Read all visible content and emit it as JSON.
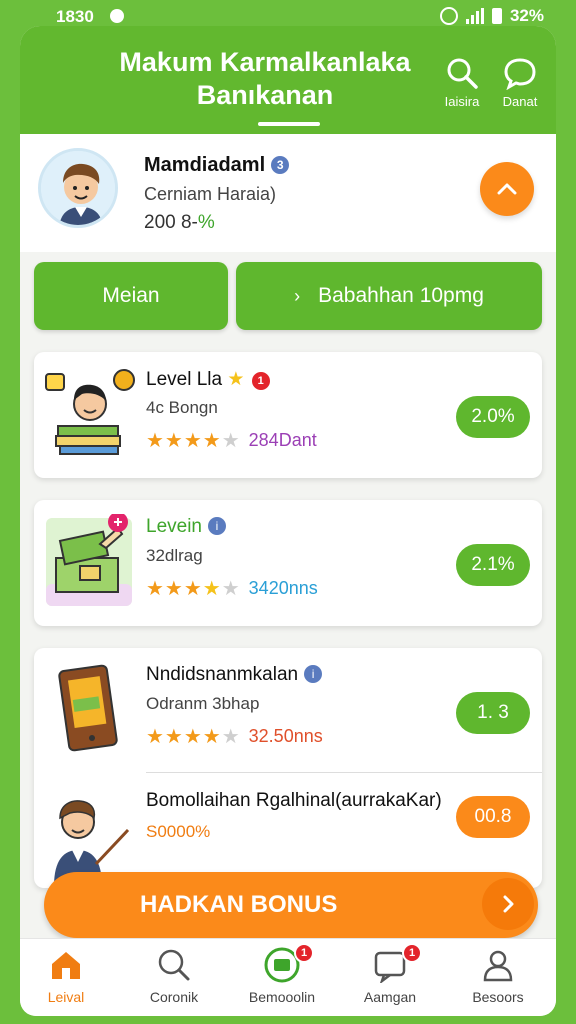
{
  "status_bar": {
    "time": "1830",
    "battery": "32%"
  },
  "header": {
    "title_line1": "Makum Karmalkanlaka",
    "title_line2": "Banıkanan",
    "search_label": "Iaisira",
    "chat_label": "Danat",
    "chat_badge": ""
  },
  "profile": {
    "name": "Mamdiadaml",
    "info_badge": "3",
    "subtitle": "Cerniam Haraia)",
    "stat_prefix": "200 8-",
    "stat_pct": "%"
  },
  "actions": {
    "left_label": "Meian",
    "right_label": "Babahhan 10pmg"
  },
  "items": [
    {
      "title": "Level Lla",
      "badge": "1",
      "subtitle": "4c Bongn",
      "rating": 3.5,
      "count": "284Dant",
      "count_color": "#9b3fb5",
      "percent": "2.0%"
    },
    {
      "title": "Levein",
      "badge": "",
      "subtitle": "32dlrag",
      "rating": 3.5,
      "count": "3420nns",
      "count_color": "#2a9fd6",
      "percent": "2.1%"
    },
    {
      "title": "Nndidsnanmkalan",
      "badge": "",
      "subtitle": "Odranm 3bhap",
      "rating": 3.5,
      "count": "32.50nns",
      "count_color": "#e0502b",
      "percent": "1. 3"
    },
    {
      "title": "Bomollaihan Rgalhinal(aurrakaKar)",
      "subtitle": "S0000%",
      "percent": "00.8"
    }
  ],
  "bonus_button": {
    "label": "HADKAN BONUS"
  },
  "bottom_nav": [
    {
      "label": "Leival",
      "icon": "home-icon",
      "badge": ""
    },
    {
      "label": "Coronik",
      "icon": "search-icon",
      "badge": ""
    },
    {
      "label": "Bemooolin",
      "icon": "wallet-icon",
      "badge": "1"
    },
    {
      "label": "Aamgan",
      "icon": "message-icon",
      "badge": "1"
    },
    {
      "label": "Besoors",
      "icon": "user-icon",
      "badge": ""
    }
  ],
  "colors": {
    "primary_green": "#62b82f",
    "accent_orange": "#fb8a1a",
    "badge_red": "#e3242b"
  }
}
